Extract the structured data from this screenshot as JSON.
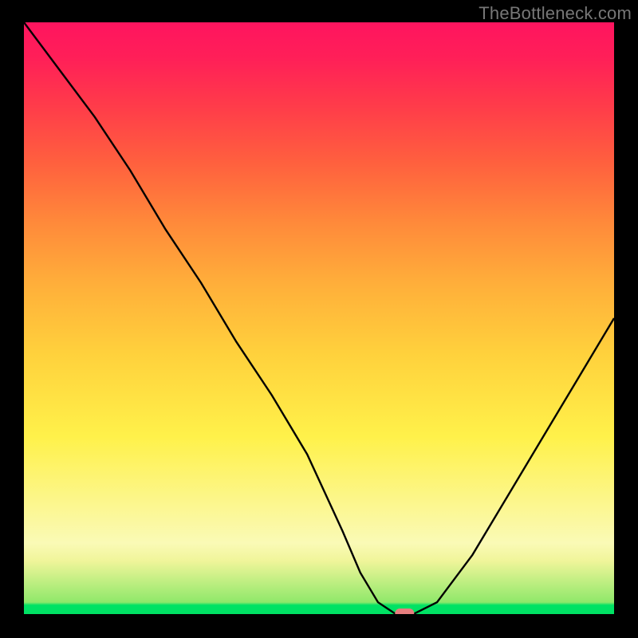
{
  "watermark": "TheBottleneck.com",
  "chart_data": {
    "type": "line",
    "title": "",
    "xlabel": "",
    "ylabel": "",
    "x_range": [
      0,
      100
    ],
    "y_range": [
      0,
      100
    ],
    "series": [
      {
        "name": "bottleneck-curve",
        "x": [
          0,
          6,
          12,
          18,
          24,
          30,
          36,
          42,
          48,
          54,
          57,
          60,
          63,
          66,
          70,
          76,
          82,
          88,
          94,
          100
        ],
        "y": [
          100,
          92,
          84,
          75,
          65,
          56,
          46,
          37,
          27,
          14,
          7,
          2,
          0,
          0,
          2,
          10,
          20,
          30,
          40,
          50
        ]
      }
    ],
    "marker": {
      "x": 64.5,
      "y": 0,
      "color": "#e77e7e"
    },
    "gradient_stops": [
      {
        "pos": 0.0,
        "color": "#00e264"
      },
      {
        "pos": 0.015,
        "color": "#00e264"
      },
      {
        "pos": 0.02,
        "color": "#8fe86a"
      },
      {
        "pos": 0.09,
        "color": "#f0f59a"
      },
      {
        "pos": 0.12,
        "color": "#fafab6"
      },
      {
        "pos": 0.3,
        "color": "#fff14a"
      },
      {
        "pos": 0.44,
        "color": "#ffd13c"
      },
      {
        "pos": 0.56,
        "color": "#ffae3a"
      },
      {
        "pos": 0.66,
        "color": "#ff8a3a"
      },
      {
        "pos": 0.76,
        "color": "#ff613e"
      },
      {
        "pos": 0.86,
        "color": "#ff3b4a"
      },
      {
        "pos": 0.94,
        "color": "#ff1f58"
      },
      {
        "pos": 1.0,
        "color": "#ff145f"
      }
    ]
  }
}
